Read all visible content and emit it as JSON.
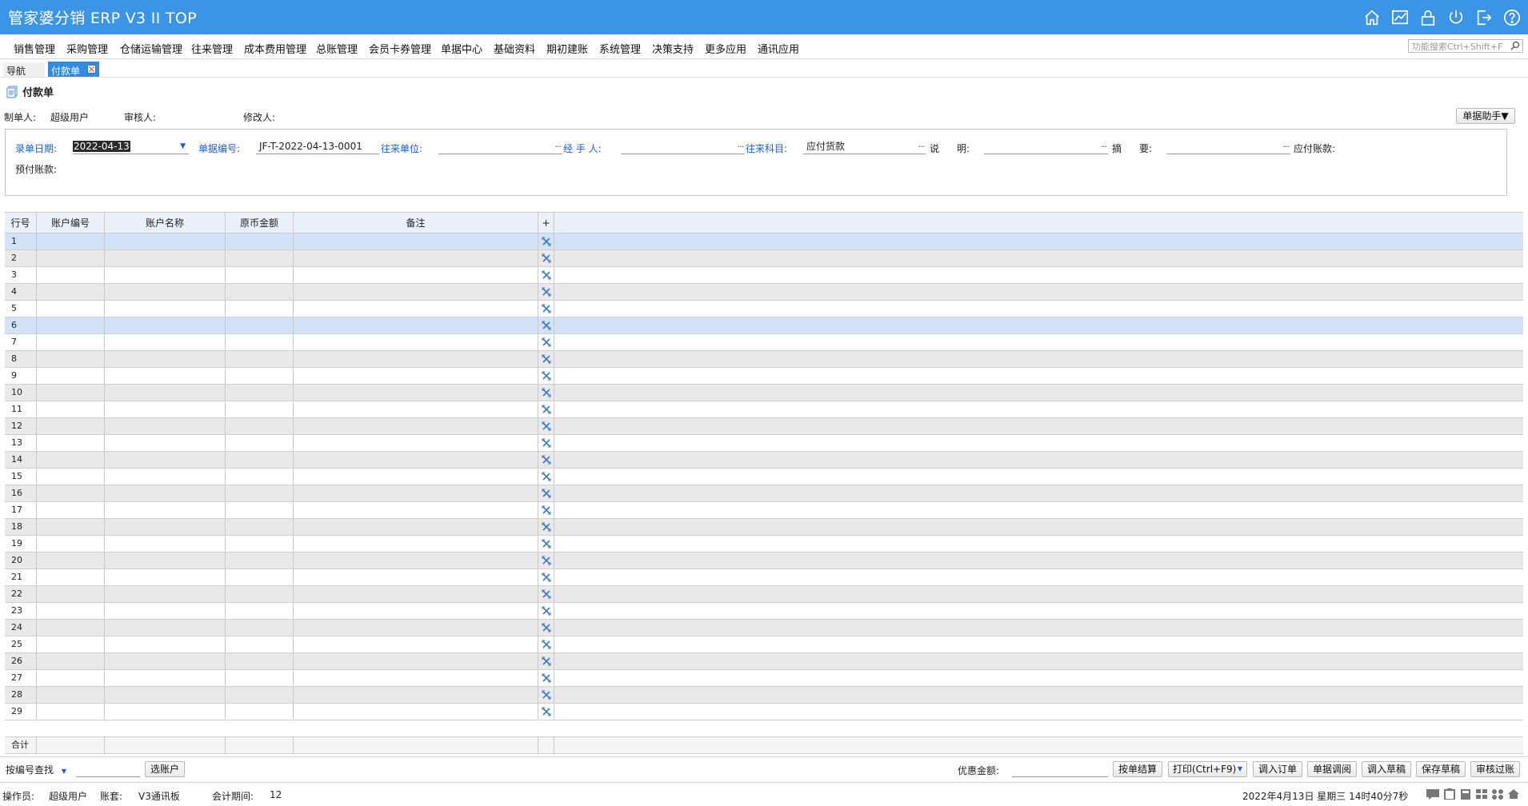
{
  "window": {
    "title": "管家婆分销 ERP V3 II TOP"
  },
  "title_icons": [
    "home-icon",
    "chart-icon",
    "lock-icon",
    "power-icon",
    "logout-icon",
    "help-icon"
  ],
  "menu": [
    "销售管理",
    "采购管理",
    "仓储运输管理",
    "往来管理",
    "成本费用管理",
    "总账管理",
    "会员卡券管理",
    "单据中心",
    "基础资料",
    "期初建账",
    "系统管理",
    "决策支持",
    "更多应用",
    "通讯应用"
  ],
  "search": {
    "placeholder": "功能搜索Ctrl+Shift+F"
  },
  "tabs": {
    "nav": "导航",
    "active": "付款单"
  },
  "doc": {
    "title": "付款单",
    "maker_label": "制单人:",
    "maker_value": "超级用户",
    "auditor_label": "审核人:",
    "modifier_label": "修改人:",
    "helper_button": "单据助手▼"
  },
  "form": {
    "date_label": "录单日期:",
    "date_value": "2022-04-13",
    "docno_label": "单据编号:",
    "docno_value": "JF-T-2022-04-13-0001",
    "partner_label": "往来单位:",
    "partner_value": "",
    "handler_label": "经 手 人:",
    "handler_value": "",
    "subject_label": "往来科目:",
    "subject_value": "应付货款",
    "desc_label_1": "说",
    "desc_label_2": "明:",
    "desc_value": "",
    "summary_label_1": "摘",
    "summary_label_2": "要:",
    "summary_value": "",
    "payable_label": "应付账款:",
    "prepaid_label": "预付账款:"
  },
  "table": {
    "columns": [
      "行号",
      "账户编号",
      "账户名称",
      "原币金额",
      "备注",
      "+"
    ],
    "rows": [
      "1",
      "2",
      "3",
      "4",
      "5",
      "6",
      "7",
      "8",
      "9",
      "10",
      "11",
      "12",
      "13",
      "14",
      "15",
      "16",
      "17",
      "18",
      "19",
      "20",
      "21",
      "22",
      "23",
      "24",
      "25",
      "26",
      "27",
      "28",
      "29"
    ],
    "highlighted_rows": [
      1,
      6
    ],
    "total_label": "合计"
  },
  "bottom": {
    "search_mode": "按编号查找",
    "select_account_button": "选账户",
    "discount_label": "优惠金额:",
    "buttons": [
      "按单结算",
      "打印(Ctrl+F9)",
      "调入订单",
      "单据调阅",
      "调入草稿",
      "保存草稿",
      "审核过账"
    ]
  },
  "status": {
    "operator_label": "操作员:",
    "operator_value": "超级用户",
    "account_label": "账套:",
    "account_value": "V3通讯板",
    "period_label": "会计期间:",
    "period_value": "12",
    "datetime": "2022年4月13日  星期三  14时40分7秒"
  },
  "colors": {
    "titlebar": "#3b95e6",
    "tab_active": "#2f8ce0",
    "header_bg": "#eaf1fb",
    "row_alt": "#e9e9e9",
    "row_selected": "#d3e3f7",
    "field_label_blue": "#1b5dd6"
  }
}
